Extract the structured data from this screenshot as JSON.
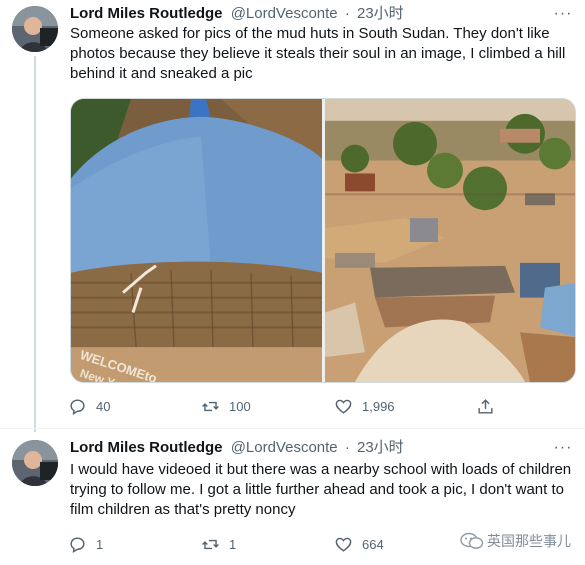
{
  "tweets": [
    {
      "author_name": "Lord Miles Routledge",
      "handle": "@LordVesconte",
      "separator": "·",
      "time": "23小时",
      "text": "Someone asked for pics of the mud huts in South Sudan. They don't like photos because they believe it steals their soul in an image, I climbed a hill behind it and sneaked a pic",
      "media_left_painted_text": "WELCOME to New Year",
      "replies": "40",
      "retweets": "100",
      "likes": "1,996"
    },
    {
      "author_name": "Lord Miles Routledge",
      "handle": "@LordVesconte",
      "separator": "·",
      "time": "23小时",
      "text": "I would have videoed it but there was a nearby school with loads of children trying to follow me. I got a little further ahead and took a pic, I don't want to film children as that's pretty noncy",
      "replies": "1",
      "retweets": "1",
      "likes": "664"
    }
  ],
  "watermark": "英国那些事儿",
  "icons": {
    "more": "more-icon",
    "reply": "reply-icon",
    "retweet": "retweet-icon",
    "like": "heart-icon",
    "share": "share-icon"
  },
  "colors": {
    "text_primary": "#0f1419",
    "text_secondary": "#536471",
    "divider": "#eff3f4",
    "thread_line": "#cfd9de"
  }
}
